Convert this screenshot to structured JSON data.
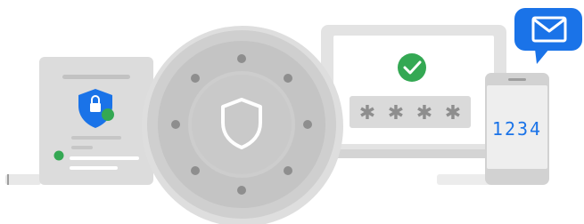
{
  "illustration": {
    "pin_code": "1234",
    "password_mask": [
      "✱",
      "✱",
      "✱",
      "✱"
    ],
    "icons": {
      "document": "secure-document-icon",
      "vault": "vault-shield-icon",
      "laptop": "laptop-password-icon",
      "check": "check-icon",
      "phone": "phone-icon",
      "mail": "mail-icon"
    },
    "colors": {
      "brand_blue": "#1a73e8",
      "success_green": "#34a853",
      "grey_dark": "#bdbdbd",
      "grey_light": "#e0e0e0",
      "vault_grey": "#cfcfcf"
    }
  }
}
